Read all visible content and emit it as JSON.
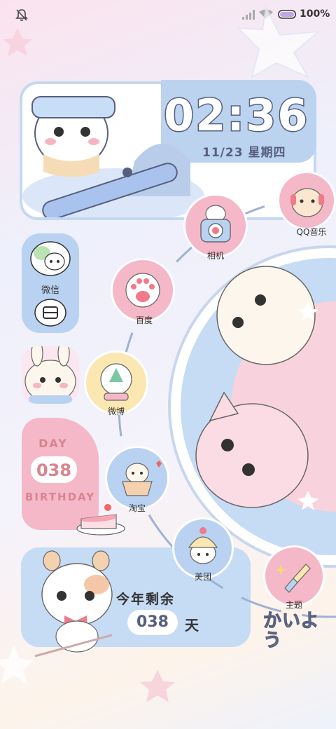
{
  "status": {
    "battery": "100%",
    "icons": [
      "bell-off-icon",
      "signal-icon",
      "wifi-icon",
      "battery-icon"
    ]
  },
  "clock": {
    "time": "02:36",
    "date": "11/23 星期四"
  },
  "apps": {
    "wechat": "微信",
    "qqmusic": "QQ音乐",
    "camera": "相机",
    "baidu": "百度",
    "weibo": "微博",
    "taobao": "淘宝",
    "meituan": "美团",
    "theme": "主题"
  },
  "day_widget": {
    "top": "DAY",
    "count": "038",
    "bottom": "BIRTHDAY"
  },
  "countdown": {
    "label": "今年剩余",
    "count": "038",
    "unit": "天"
  },
  "deco_text": "かいよう",
  "colors": {
    "pink": "#f4b8c8",
    "blue": "#b9d2f1",
    "yellow": "#fbe7b1",
    "dark": "#56607e"
  }
}
